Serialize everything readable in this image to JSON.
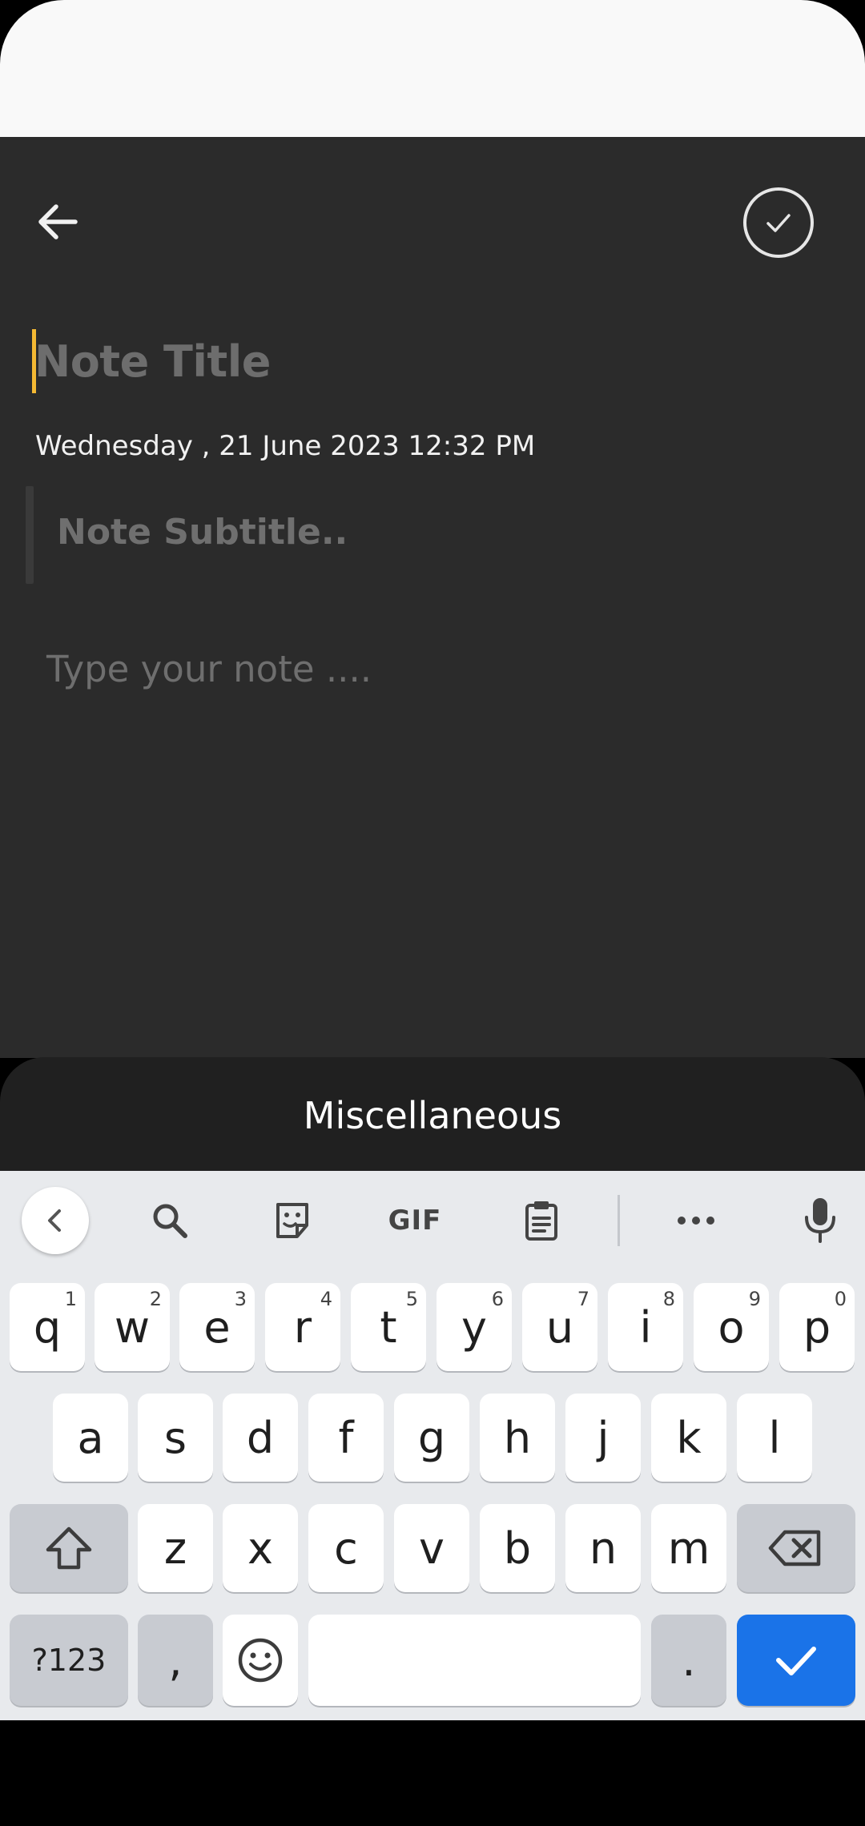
{
  "editor": {
    "title_placeholder": "Note Title",
    "date": "Wednesday , 21 June 2023 12:32 PM",
    "subtitle_placeholder": "Note Subtitle..",
    "note_placeholder": "Type your note ....",
    "caret_color": "#f5b933",
    "background_color": "#2b2b2b"
  },
  "icons": {
    "back": "arrow-left",
    "done": "check-circle"
  },
  "misc_sheet": {
    "label": "Miscellaneous"
  },
  "keyboard": {
    "toolbar": {
      "collapse": "chevron-left",
      "search": "search",
      "sticker": "sticker",
      "gif_label": "GIF",
      "clipboard": "clipboard",
      "more": "more-horizontal",
      "voice": "microphone"
    },
    "row1": [
      {
        "ch": "q",
        "num": "1"
      },
      {
        "ch": "w",
        "num": "2"
      },
      {
        "ch": "e",
        "num": "3"
      },
      {
        "ch": "r",
        "num": "4"
      },
      {
        "ch": "t",
        "num": "5"
      },
      {
        "ch": "y",
        "num": "6"
      },
      {
        "ch": "u",
        "num": "7"
      },
      {
        "ch": "i",
        "num": "8"
      },
      {
        "ch": "o",
        "num": "9"
      },
      {
        "ch": "p",
        "num": "0"
      }
    ],
    "row2": [
      "a",
      "s",
      "d",
      "f",
      "g",
      "h",
      "j",
      "k",
      "l"
    ],
    "row3": [
      "z",
      "x",
      "c",
      "v",
      "b",
      "n",
      "m"
    ],
    "symbols_label": "?123",
    "comma_label": ",",
    "period_label": ".",
    "enter_color": "#1a73e8"
  }
}
